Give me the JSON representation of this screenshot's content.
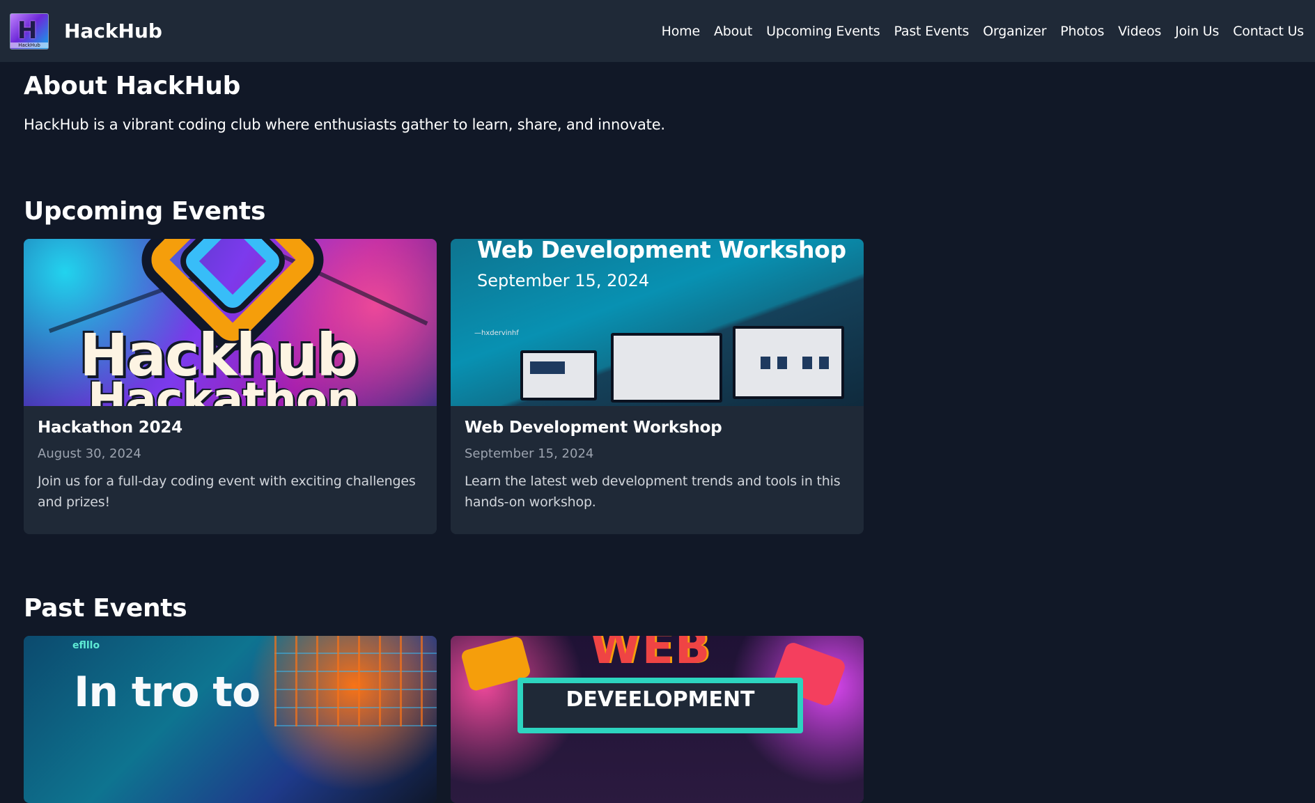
{
  "navbar": {
    "brand_name": "HackHub",
    "logo_glyph": "H",
    "logo_caption": "HackHub",
    "links": [
      "Home",
      "About",
      "Upcoming Events",
      "Past Events",
      "Organizer",
      "Photos",
      "Videos",
      "Join Us",
      "Contact Us"
    ]
  },
  "about": {
    "title": "About HackHub",
    "text": "HackHub is a vibrant coding club where enthusiasts gather to learn, share, and innovate."
  },
  "upcoming": {
    "title": "Upcoming Events",
    "events": [
      {
        "title": "Hackathon 2024",
        "date": "August 30, 2024",
        "description": "Join us for a full-day coding event with exciting challenges and prizes!",
        "image_text": [
          "Hackhub",
          "Hackathon"
        ]
      },
      {
        "title": "Web Development Workshop",
        "date": "September 15, 2024",
        "description": "Learn the latest web development trends and tools in this hands-on workshop.",
        "image_text": [
          "Web Development  Workshop",
          "September 15, 2024",
          "—hxdervinhf"
        ]
      }
    ]
  },
  "past": {
    "title": "Past Events",
    "events": [
      {
        "image_text": [
          "In tro to"
        ],
        "logo_text": "eflllo"
      },
      {
        "image_text": [
          "WEB",
          "DEVEELOPMENT"
        ]
      }
    ]
  },
  "colors": {
    "background": "#111827",
    "navbar": "#1f2937",
    "card": "#1f2937",
    "muted_text": "#9ca3af"
  }
}
